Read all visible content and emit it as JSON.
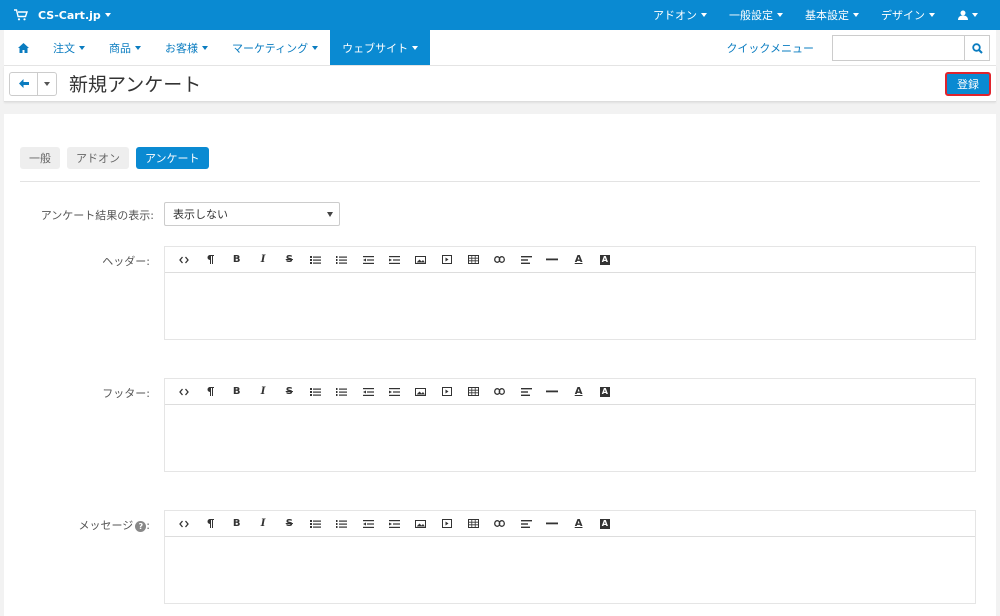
{
  "topbar": {
    "brand": "CS-Cart.jp",
    "menus": [
      "アドオン",
      "一般設定",
      "基本設定",
      "デザイン"
    ]
  },
  "nav": {
    "items": [
      "注文",
      "商品",
      "お客様",
      "マーケティング",
      "ウェブサイト"
    ],
    "active_index": 4,
    "quick_menu": "クイックメニュー",
    "search_placeholder": ""
  },
  "title": {
    "text": "新規アンケート",
    "save_label": "登録"
  },
  "tabs": [
    {
      "label": "一般",
      "active": false
    },
    {
      "label": "アドオン",
      "active": false
    },
    {
      "label": "アンケート",
      "active": true
    }
  ],
  "form": {
    "results_label": "アンケート結果の表示:",
    "results_value": "表示しない",
    "header_label": "ヘッダー:",
    "footer_label": "フッター:",
    "message_label": "メッセージ",
    "message_suffix": ":",
    "help_glyph": "?"
  },
  "editor_toolbar": [
    "code-icon",
    "paragraph-icon",
    "bold-icon",
    "italic-icon",
    "strikethrough-icon",
    "unordered-list-icon",
    "ordered-list-icon",
    "outdent-icon",
    "indent-icon",
    "image-icon",
    "video-icon",
    "table-icon",
    "link-icon",
    "align-icon",
    "horizontal-rule-icon",
    "font-color-icon",
    "back-color-icon"
  ],
  "colors": {
    "accent": "#0a8ad2",
    "highlight_border": "#e0242d"
  }
}
